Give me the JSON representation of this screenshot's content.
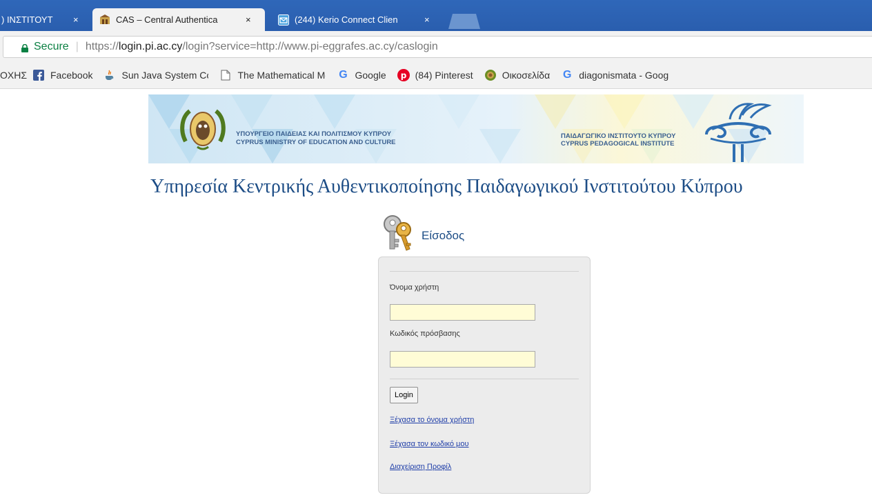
{
  "browser": {
    "tabs": [
      {
        "label": ") ΙΝΣΤΙΤΟΥΤ",
        "close": "×"
      },
      {
        "label": "CAS – Central Authentica",
        "close": "×"
      },
      {
        "label": "(244) Kerio Connect Clien",
        "close": "×"
      }
    ],
    "address": {
      "secure_label": "Secure",
      "url_scheme": "https://",
      "url_host": "login.pi.ac.cy",
      "url_path": "/login?service=http://www.pi-eggrafes.ac.cy/caslogin"
    },
    "bookmarks": [
      {
        "label": "ΟΧΗΣ",
        "icon": "none"
      },
      {
        "label": "Facebook",
        "icon": "facebook-icon"
      },
      {
        "label": "Sun Java System Com",
        "icon": "java-cup-icon"
      },
      {
        "label": "The Mathematical Mo",
        "icon": "page-icon"
      },
      {
        "label": "Google",
        "icon": "google-icon"
      },
      {
        "label": "(84) Pinterest",
        "icon": "pinterest-icon"
      },
      {
        "label": "Οικοσελίδα",
        "icon": "crest-icon"
      },
      {
        "label": "diagonismata - Goog",
        "icon": "google-icon"
      }
    ]
  },
  "banner": {
    "ministry_gr": "ΥΠΟΥΡΓΕΙΟ ΠΑΙΔΕΙΑΣ ΚΑΙ ΠΟΛΙΤΙΣΜΟΥ ΚΥΠΡΟΥ",
    "ministry_en": "CYPRUS MINISTRY OF EDUCATION AND CULTURE",
    "institute_gr": "ΠΑΙΔΑΓΩΓΙΚΟ ΙΝΣΤΙΤΟΥΤΟ ΚΥΠΡΟΥ",
    "institute_en": "CYPRUS PEDAGOGICAL INSTITUTE"
  },
  "page": {
    "title": "Υπηρεσία Κεντρικής Αυθεντικοποίησης Παιδαγωγικού Ινστιτούτου Κύπρου",
    "login_heading": "Είσοδος"
  },
  "form": {
    "username_label": "Όνομα χρήστη",
    "username_value": "",
    "password_label": "Κωδικός πρόσβασης",
    "password_value": "",
    "login_button": "Login",
    "forgot_username": "Ξέχασα το όνομα χρήστη",
    "forgot_password": "Ξέχασα τον κωδικό μου",
    "manage_profile": "Διαχείριση Προφίλ"
  },
  "colors": {
    "tabstrip": "#2f67b9",
    "title_blue": "#1d4d86",
    "field_bg": "#fffcd6",
    "link": "#1f3ea8",
    "secure_green": "#0b8043"
  }
}
